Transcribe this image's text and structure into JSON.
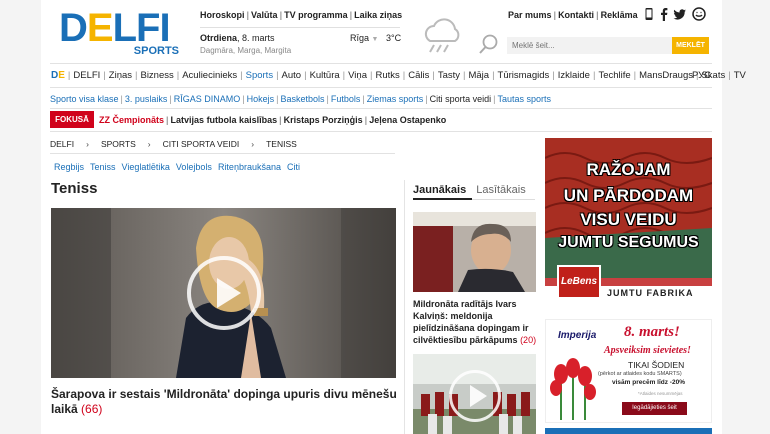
{
  "header": {
    "logo_word": "DELFI",
    "logo_sub": "SPORTS",
    "top_links": [
      "Horoskopi",
      "Valūta",
      "TV programma",
      "Laika ziņas"
    ],
    "date_label": "Otrdiena",
    "date_value": ", 8. marts",
    "name_days": "Dagmāra, Marga, Margita",
    "city": "Rīga",
    "temperature": "3°C",
    "search_placeholder": "Meklē šeit...",
    "search_button": "MEKLĒT",
    "right_links": [
      "Par mums",
      "Kontakti",
      "Reklāma"
    ],
    "social_icons": [
      "mobile-icon",
      "facebook-icon",
      "twitter-icon",
      "draugiem-icon"
    ]
  },
  "nav": {
    "logo": "DE",
    "items": [
      "DELFI",
      "Ziņas",
      "Bizness",
      "Aculiecinieks",
      "Sports",
      "Auto",
      "Kultūra",
      "Viņa",
      "Rutks",
      "Cālis",
      "Tasty",
      "Māja",
      "Tūrismagids",
      "Izklaide",
      "Techlife",
      "MansDraugs",
      "Skats",
      "TV"
    ],
    "active": "Sports",
    "lang": "РУС"
  },
  "subnav": {
    "items": [
      "Sporto visa klase",
      "3. puslaiks",
      "RĪGAS DINAMO",
      "Hokejs",
      "Basketbols",
      "Futbols",
      "Ziemas sports",
      "Citi sporta veidi",
      "Tautas sports"
    ],
    "current": "Citi sporta veidi"
  },
  "focus": {
    "badge": "FOKUSĀ",
    "items": [
      "ZZ Čempionāts",
      "Latvijas futbola kaislības",
      "Kristaps Porziņģis",
      "Jeļena Ostapenko"
    ]
  },
  "breadcrumb": [
    "DELFI",
    "SPORTS",
    "CITI SPORTA VEIDI",
    "TENISS"
  ],
  "tags": [
    "Regbijs",
    "Teniss",
    "Vieglatlētika",
    "Volejbols",
    "Riteņbraukšana",
    "Citi"
  ],
  "page": {
    "title": "Teniss",
    "main_headline": "Šarapova ir sestais 'Mildronāta' dopinga upuris divu mēnešu laikā",
    "main_comments": "(66)"
  },
  "side": {
    "tab_latest": "Jaunākais",
    "tab_read": "Lasītākais",
    "article1_title": "Mildronāta radītājs Ivars Kalviņš: meldonija pielīdzināšana dopingam ir cilvēktiesību pārkāpums",
    "article1_comments": "(20)"
  },
  "ads": {
    "ad1_lines": [
      "RAŽOJAM",
      "UN PĀRDODAM",
      "VISU VEIDU",
      "JUMTU SEGUMUS"
    ],
    "ad1_brand": "LeBens",
    "ad1_tagline": "JUMTU FABRIKA",
    "ad2_brand": "Imperija",
    "ad2_headline": "8. marts!",
    "ad2_sub": "Apsveiksim sievietes!",
    "ad2_today": "TIKAI ŠODIEN",
    "ad2_line1": "(pērkot ar atlaides kodu SMARTS)",
    "ad2_line2": "visām precēm līdz -20%",
    "ad2_note": "*Atlaides nesummējas",
    "ad2_cta": "Iegādājieties šeit"
  },
  "colors": {
    "brand_blue": "#1a6fb7",
    "brand_yellow": "#f5b400",
    "accent_red": "#d0021b"
  }
}
